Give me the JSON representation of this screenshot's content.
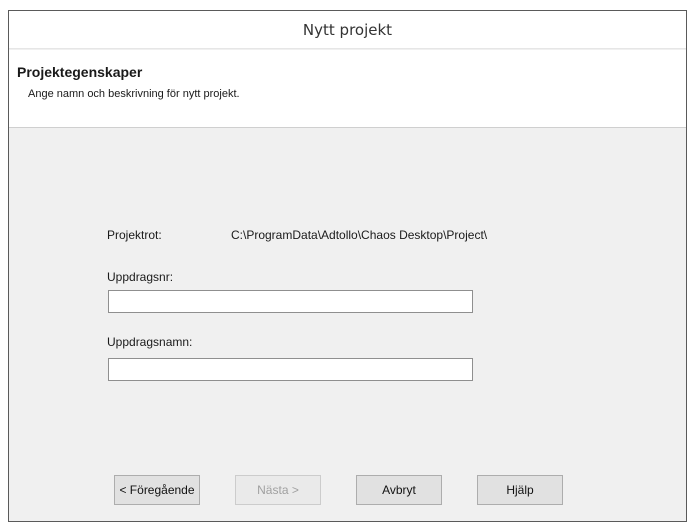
{
  "window": {
    "title": "Nytt projekt"
  },
  "header": {
    "heading": "Projektegenskaper",
    "subheading": "Ange namn och beskrivning för nytt projekt."
  },
  "form": {
    "project_root_label": "Projektrot:",
    "project_root_value": "C:\\ProgramData\\Adtollo\\Chaos Desktop\\Project\\",
    "assignment_number_label": "Uppdragsnr:",
    "assignment_number_value": "",
    "assignment_name_label": "Uppdragsnamn:",
    "assignment_name_value": ""
  },
  "buttons": {
    "previous": "< Föregående",
    "next": "Nästa >",
    "cancel": "Avbryt",
    "help": "Hjälp"
  }
}
